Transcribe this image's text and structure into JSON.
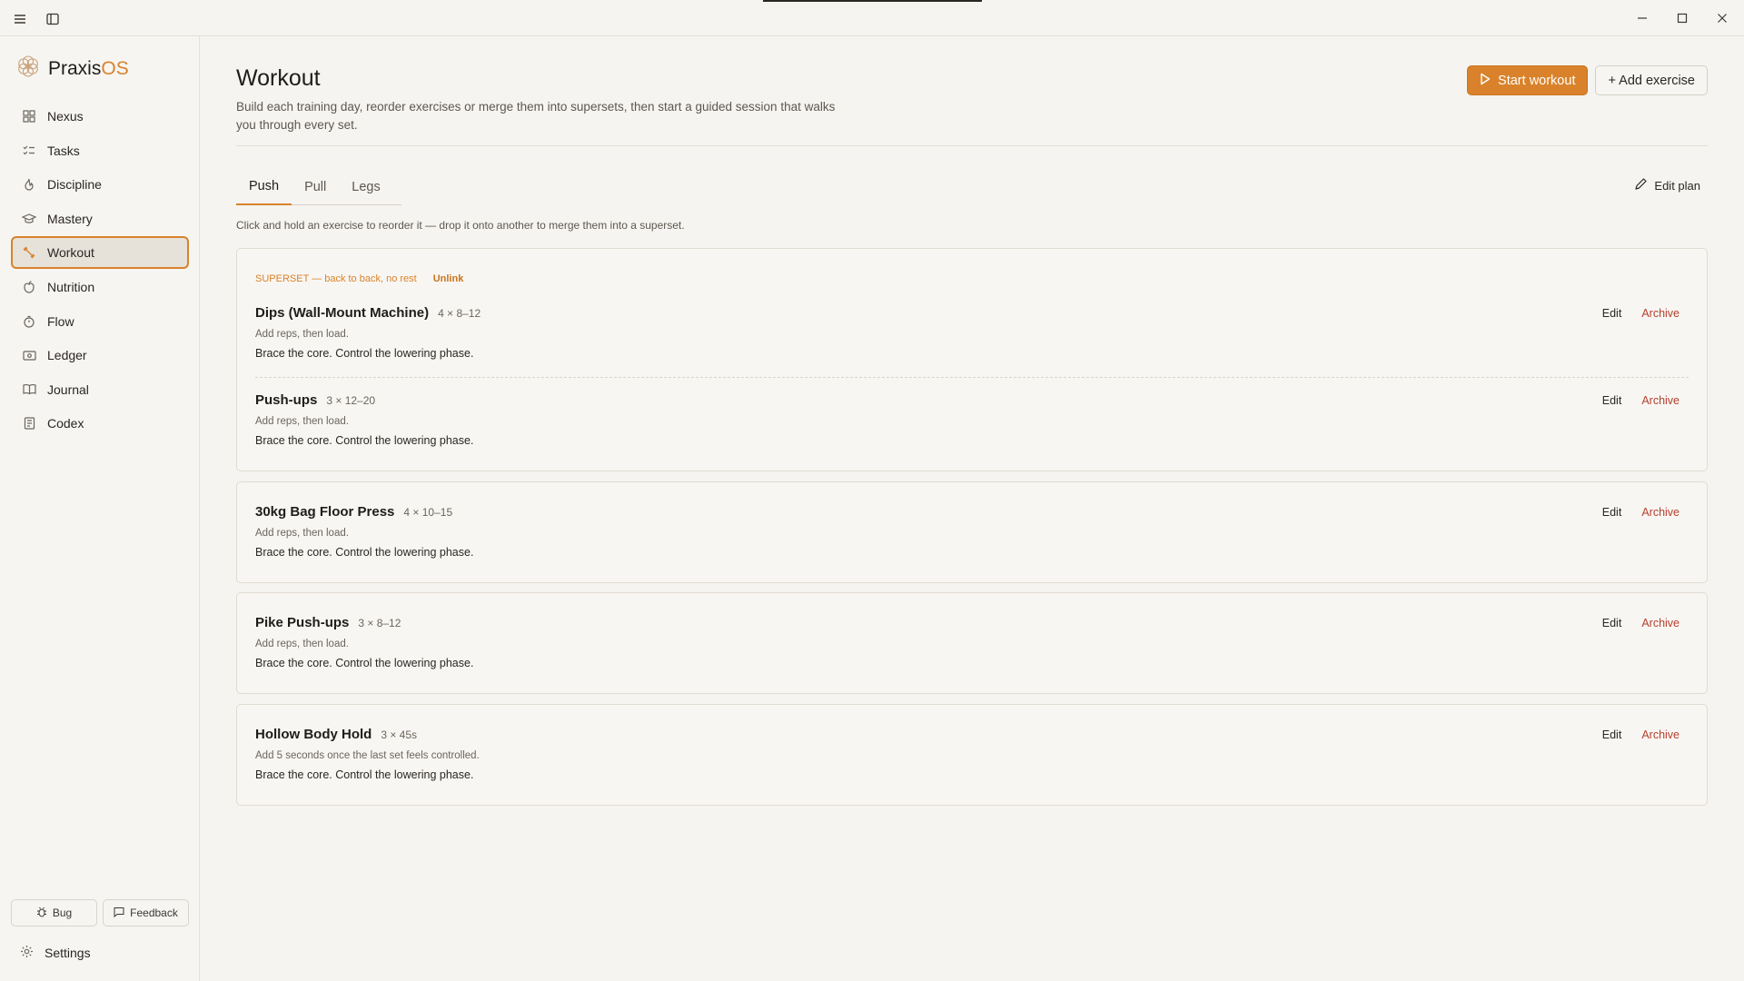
{
  "app": {
    "brand_main": "Praxis",
    "brand_accent": "OS",
    "accent_color": "#d9822b",
    "archive_color": "#b5402f"
  },
  "sidebar": {
    "items": [
      {
        "label": "Nexus",
        "icon": "grid-icon"
      },
      {
        "label": "Tasks",
        "icon": "checklist-icon"
      },
      {
        "label": "Discipline",
        "icon": "flame-icon"
      },
      {
        "label": "Mastery",
        "icon": "graduation-cap-icon"
      },
      {
        "label": "Workout",
        "icon": "dumbbell-icon",
        "active": true
      },
      {
        "label": "Nutrition",
        "icon": "apple-icon"
      },
      {
        "label": "Flow",
        "icon": "timer-icon"
      },
      {
        "label": "Ledger",
        "icon": "wallet-icon"
      },
      {
        "label": "Journal",
        "icon": "book-icon"
      },
      {
        "label": "Codex",
        "icon": "notebook-icon"
      }
    ],
    "bug_label": "Bug",
    "feedback_label": "Feedback",
    "settings_label": "Settings"
  },
  "header": {
    "title": "Workout",
    "description": "Build each training day, reorder exercises or merge them into supersets, then start a guided session that walks you through every set.",
    "start_label": "Start workout",
    "add_label": "+ Add exercise"
  },
  "tabs": [
    {
      "label": "Push",
      "active": true
    },
    {
      "label": "Pull"
    },
    {
      "label": "Legs"
    }
  ],
  "edit_plan_label": "Edit plan",
  "hint": "Click and hold an exercise to reorder it — drop it onto another to merge them into a superset.",
  "superset": {
    "label": "SUPERSET — back to back, no rest",
    "unlink_label": "Unlink"
  },
  "actions": {
    "edit": "Edit",
    "archive": "Archive"
  },
  "exercises": [
    {
      "name": "Dips (Wall-Mount Machine)",
      "sets": "4 × 8–12",
      "progression": "Add reps, then load.",
      "note": "Brace the core. Control the lowering phase."
    },
    {
      "name": "Push-ups",
      "sets": "3 × 12–20",
      "progression": "Add reps, then load.",
      "note": "Brace the core. Control the lowering phase."
    },
    {
      "name": "30kg Bag Floor Press",
      "sets": "4 × 10–15",
      "progression": "Add reps, then load.",
      "note": "Brace the core. Control the lowering phase."
    },
    {
      "name": "Pike Push-ups",
      "sets": "3 × 8–12",
      "progression": "Add reps, then load.",
      "note": "Brace the core. Control the lowering phase."
    },
    {
      "name": "Hollow Body Hold",
      "sets": "3 × 45s",
      "progression": "Add 5 seconds once the last set feels controlled.",
      "note": "Brace the core. Control the lowering phase."
    }
  ]
}
